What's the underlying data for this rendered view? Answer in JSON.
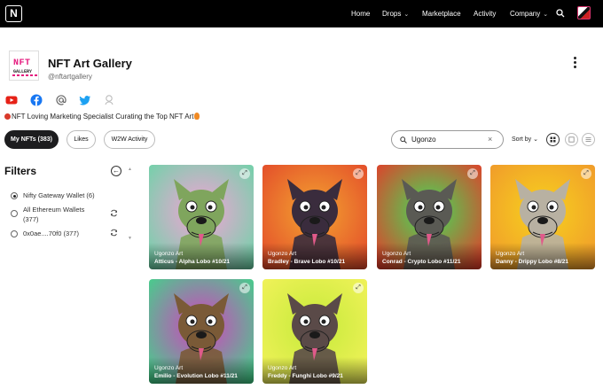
{
  "topbar": {
    "logo_letter": "N",
    "nav": [
      {
        "label": "Home",
        "has_chevron": false
      },
      {
        "label": "Drops",
        "has_chevron": true
      },
      {
        "label": "Marketplace",
        "has_chevron": false
      },
      {
        "label": "Activity",
        "has_chevron": false
      },
      {
        "label": "Company",
        "has_chevron": true
      }
    ]
  },
  "profile": {
    "avatar_text_line1": "NFT",
    "avatar_text_line2": "GALLERY",
    "name": "NFT Art Gallery",
    "handle": "@nftartgallery",
    "bio": "NFT Loving Marketing Specialist Curating the Top NFT Art",
    "social_icons": [
      "youtube-icon",
      "facebook-icon",
      "at-sign-icon",
      "twitter-icon",
      "user-icon"
    ]
  },
  "tabs": [
    {
      "label": "My NFTs (383)",
      "active": true
    },
    {
      "label": "Likes",
      "active": false
    },
    {
      "label": "W2W Activity",
      "active": false
    }
  ],
  "search": {
    "value": "Ugonzo",
    "clear_glyph": "×"
  },
  "sort": {
    "label": "Sort by"
  },
  "view_modes": [
    "grid-large-icon",
    "grid-small-icon",
    "list-icon"
  ],
  "filters": {
    "title": "Filters",
    "back_glyph": "←",
    "wallets": [
      {
        "label": "Nifty Gateway Wallet (6)",
        "selected": true,
        "refreshable": false
      },
      {
        "label": "All Ethereum Wallets",
        "label2": "(377)",
        "selected": false,
        "refreshable": true
      },
      {
        "label": "0x0ae....70f0 (377)",
        "selected": false,
        "refreshable": true
      }
    ]
  },
  "cards": [
    {
      "artist": "Ugonzo Art",
      "title": "Atticus - Alpha Lobo #10/21",
      "bg": [
        "#f6a2d6",
        "#6ed3a8"
      ],
      "fur": "#7fa55d"
    },
    {
      "artist": "Ugonzo Art",
      "title": "Bradley - Brave Lobo #10/21",
      "bg": [
        "#f3a431",
        "#e34b2a"
      ],
      "fur": "#3a2c3d"
    },
    {
      "artist": "Ugonzo Art",
      "title": "Conrad - Crypto Lobo #11/21",
      "bg": [
        "#3fe05a",
        "#e23e2a"
      ],
      "fur": "#5a5a54"
    },
    {
      "artist": "Ugonzo Art",
      "title": "Danny - Drippy Lobo #8/21",
      "bg": [
        "#f7d21e",
        "#f09a2b"
      ],
      "fur": "#b8b1a2"
    },
    {
      "artist": "Ugonzo Art",
      "title": "Emilio - Evolution Lobo #11/21",
      "bg": [
        "#d63fbf",
        "#42d28a"
      ],
      "fur": "#7a5a37"
    },
    {
      "artist": "Ugonzo Art",
      "title": "Freddy - Funghi Lobo #9/21",
      "bg": [
        "#c5ea3a",
        "#f2f25a"
      ],
      "fur": "#5a4a48"
    }
  ]
}
